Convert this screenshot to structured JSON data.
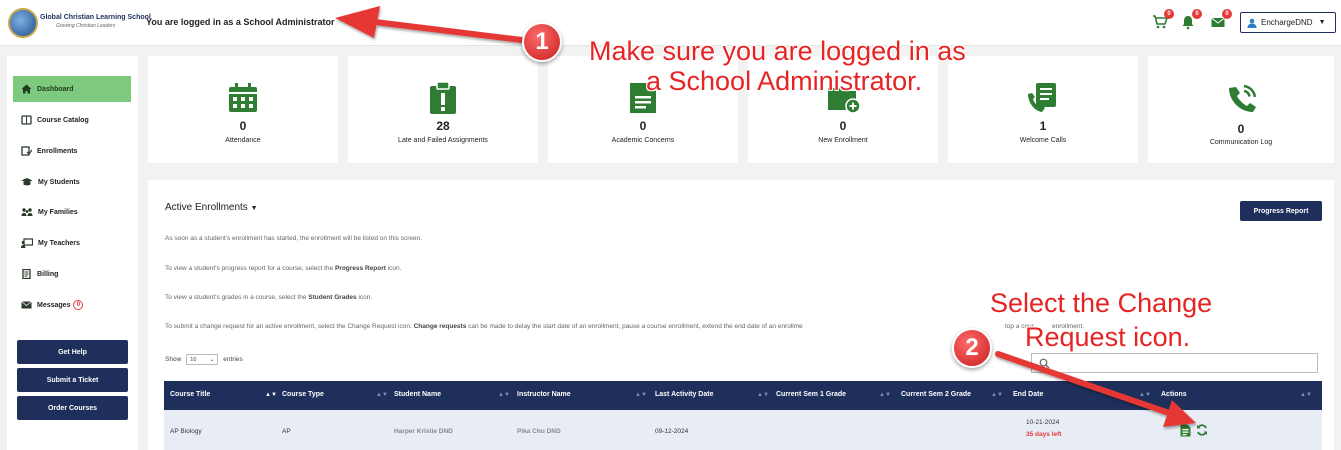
{
  "header": {
    "school_name": "Global Christian Learning School",
    "school_tagline": "Growing Christian Leaders",
    "login_message": "You are logged in as a School Administrator",
    "cart_count": "0",
    "bell_count": "0",
    "mail_count": "0",
    "user_name": "EnchargeDND"
  },
  "sidebar": {
    "items": [
      {
        "label": "Dashboard",
        "icon": "home-icon"
      },
      {
        "label": "Course Catalog",
        "icon": "book-icon"
      },
      {
        "label": "Enrollments",
        "icon": "enroll-icon"
      },
      {
        "label": "My Students",
        "icon": "graduation-cap-icon"
      },
      {
        "label": "My Families",
        "icon": "family-icon"
      },
      {
        "label": "My Teachers",
        "icon": "teacher-icon"
      },
      {
        "label": "Billing",
        "icon": "billing-icon"
      },
      {
        "label": "Messages",
        "icon": "messages-icon",
        "badge": "0"
      }
    ],
    "buttons": [
      "Get Help",
      "Submit a Ticket",
      "Order Courses"
    ]
  },
  "cards": [
    {
      "value": "0",
      "label": "Attendance",
      "icon": "calendar-icon"
    },
    {
      "value": "28",
      "label": "Late and Failed Assignments",
      "icon": "clipboard-alert-icon"
    },
    {
      "value": "0",
      "label": "Academic Concerns",
      "icon": "document-icon"
    },
    {
      "value": "0",
      "label": "New Enrollment",
      "icon": "add-folder-icon"
    },
    {
      "value": "1",
      "label": "Welcome Calls",
      "icon": "welcome-call-icon"
    },
    {
      "value": "0",
      "label": "Communication Log",
      "icon": "phone-icon"
    }
  ],
  "enrollments": {
    "title": "Active Enrollments",
    "progress_button": "Progress Report",
    "info_1": "As soon as a student's enrollment has started, the enrollment will be listed on this screen.",
    "info_2_pre": "To view a student's progress report for a course, select the ",
    "info_2_bold": "Progress Report",
    "info_2_post": " icon.",
    "info_3_pre": "To view a student's grades in a course, select the ",
    "info_3_bold": "Student Grades",
    "info_3_post": " icon.",
    "info_4_pre": "To submit a change request for an active enrollment, select the Change Request icon. ",
    "info_4_bold": "Change requests",
    "info_4_post": " can be made to delay the start date of an enrollment, pause a course enrollment, extend the end date of an enrollme",
    "info_4_tail": "top a cour",
    "info_4_end": "enrollment.",
    "show_label": "Show",
    "show_value": "10",
    "entries_label": "entries",
    "columns": [
      "Course Title",
      "Course Type",
      "Student Name",
      "Instructor Name",
      "Last Activity Date",
      "Current Sem 1 Grade",
      "Current Sem 2 Grade",
      "End Date",
      "Actions"
    ],
    "rows": [
      {
        "course_title": "AP Biology",
        "course_type": "AP",
        "student_name": "Harper Kristie DND",
        "instructor_name": "Pika Chu DND",
        "last_activity": "09-12-2024",
        "sem1": "",
        "sem2": "",
        "end_date": "10-21-2024",
        "days_left": "35 days left"
      }
    ]
  },
  "annotations": {
    "step1_number": "1",
    "step1_line1": "Make sure you are logged in as",
    "step1_line2": "a School Administrator.",
    "step2_number": "2",
    "step2_line1": "Select the Change",
    "step2_line2": "Request icon.",
    "color": "#e62424"
  },
  "colors": {
    "navy": "#1d2f5a",
    "active_green": "#7dc97d",
    "icon_green": "#2e7d32",
    "badge_red": "#e53935"
  }
}
